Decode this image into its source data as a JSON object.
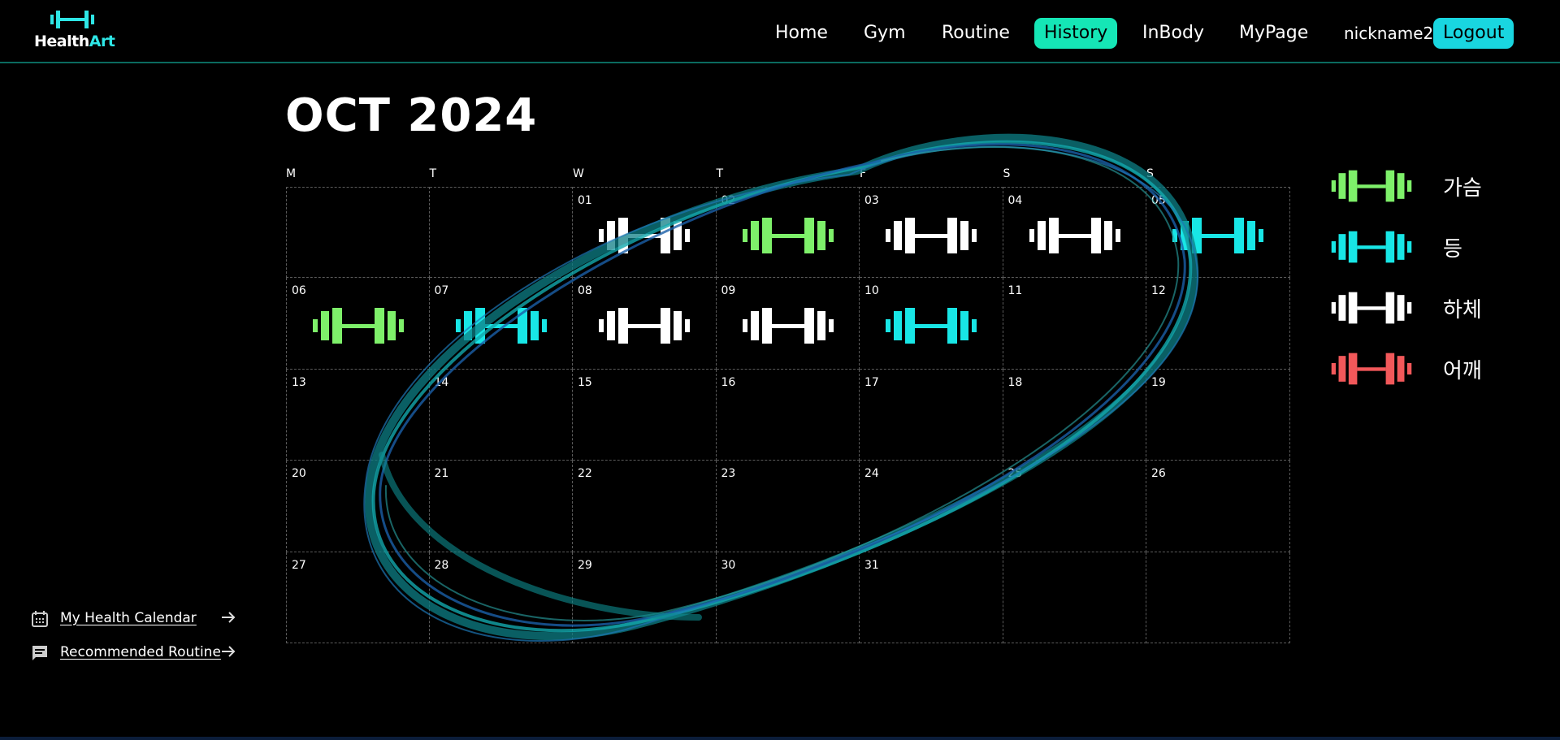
{
  "app": {
    "logo_main": "Health",
    "logo_accent": "Art"
  },
  "nav": {
    "home": "Home",
    "gym": "Gym",
    "routine": "Routine",
    "history": "History",
    "inbody": "InBody",
    "mypage": "MyPage",
    "nickname": "nickname2",
    "logout": "Logout"
  },
  "colors": {
    "accent": "#15e6b6",
    "logout_bg": "#19d6e0",
    "chest": "#7ef06a",
    "back": "#18e6e6",
    "legs": "#ffffff",
    "shoulder": "#f2585a"
  },
  "calendar": {
    "title": "OCT 2024",
    "weekdays": [
      "M",
      "T",
      "W",
      "T",
      "F",
      "S",
      "S"
    ],
    "weeks": [
      [
        {
          "day": "",
          "workout": null
        },
        {
          "day": "",
          "workout": null
        },
        {
          "day": "01",
          "workout": "legs"
        },
        {
          "day": "02",
          "workout": "chest"
        },
        {
          "day": "03",
          "workout": "legs"
        },
        {
          "day": "04",
          "workout": "legs"
        },
        {
          "day": "05",
          "workout": "back"
        }
      ],
      [
        {
          "day": "06",
          "workout": "chest"
        },
        {
          "day": "07",
          "workout": "back"
        },
        {
          "day": "08",
          "workout": "legs"
        },
        {
          "day": "09",
          "workout": "legs"
        },
        {
          "day": "10",
          "workout": "back"
        },
        {
          "day": "11",
          "workout": null
        },
        {
          "day": "12",
          "workout": null
        }
      ],
      [
        {
          "day": "13",
          "workout": null
        },
        {
          "day": "14",
          "workout": null
        },
        {
          "day": "15",
          "workout": null
        },
        {
          "day": "16",
          "workout": null
        },
        {
          "day": "17",
          "workout": null
        },
        {
          "day": "18",
          "workout": null
        },
        {
          "day": "19",
          "workout": null
        }
      ],
      [
        {
          "day": "20",
          "workout": null
        },
        {
          "day": "21",
          "workout": null
        },
        {
          "day": "22",
          "workout": null
        },
        {
          "day": "23",
          "workout": null
        },
        {
          "day": "24",
          "workout": null
        },
        {
          "day": "25",
          "workout": null
        },
        {
          "day": "26",
          "workout": null
        }
      ],
      [
        {
          "day": "27",
          "workout": null
        },
        {
          "day": "28",
          "workout": null
        },
        {
          "day": "29",
          "workout": null
        },
        {
          "day": "30",
          "workout": null
        },
        {
          "day": "31",
          "workout": null
        },
        {
          "day": "",
          "workout": null
        },
        {
          "day": "",
          "workout": null
        }
      ]
    ]
  },
  "legend": [
    {
      "key": "chest",
      "label": "가슴",
      "icon": "dumbbell-icon"
    },
    {
      "key": "back",
      "label": "등",
      "icon": "dumbbell-icon"
    },
    {
      "key": "legs",
      "label": "하체",
      "icon": "dumbbell-icon"
    },
    {
      "key": "shoulder",
      "label": "어깨",
      "icon": "dumbbell-icon"
    }
  ],
  "sidebar": {
    "calendar_link": {
      "label": "My Health Calendar",
      "icon": "calendar-icon"
    },
    "routine_link": {
      "label": "Recommended Routine",
      "icon": "chat-icon"
    }
  }
}
